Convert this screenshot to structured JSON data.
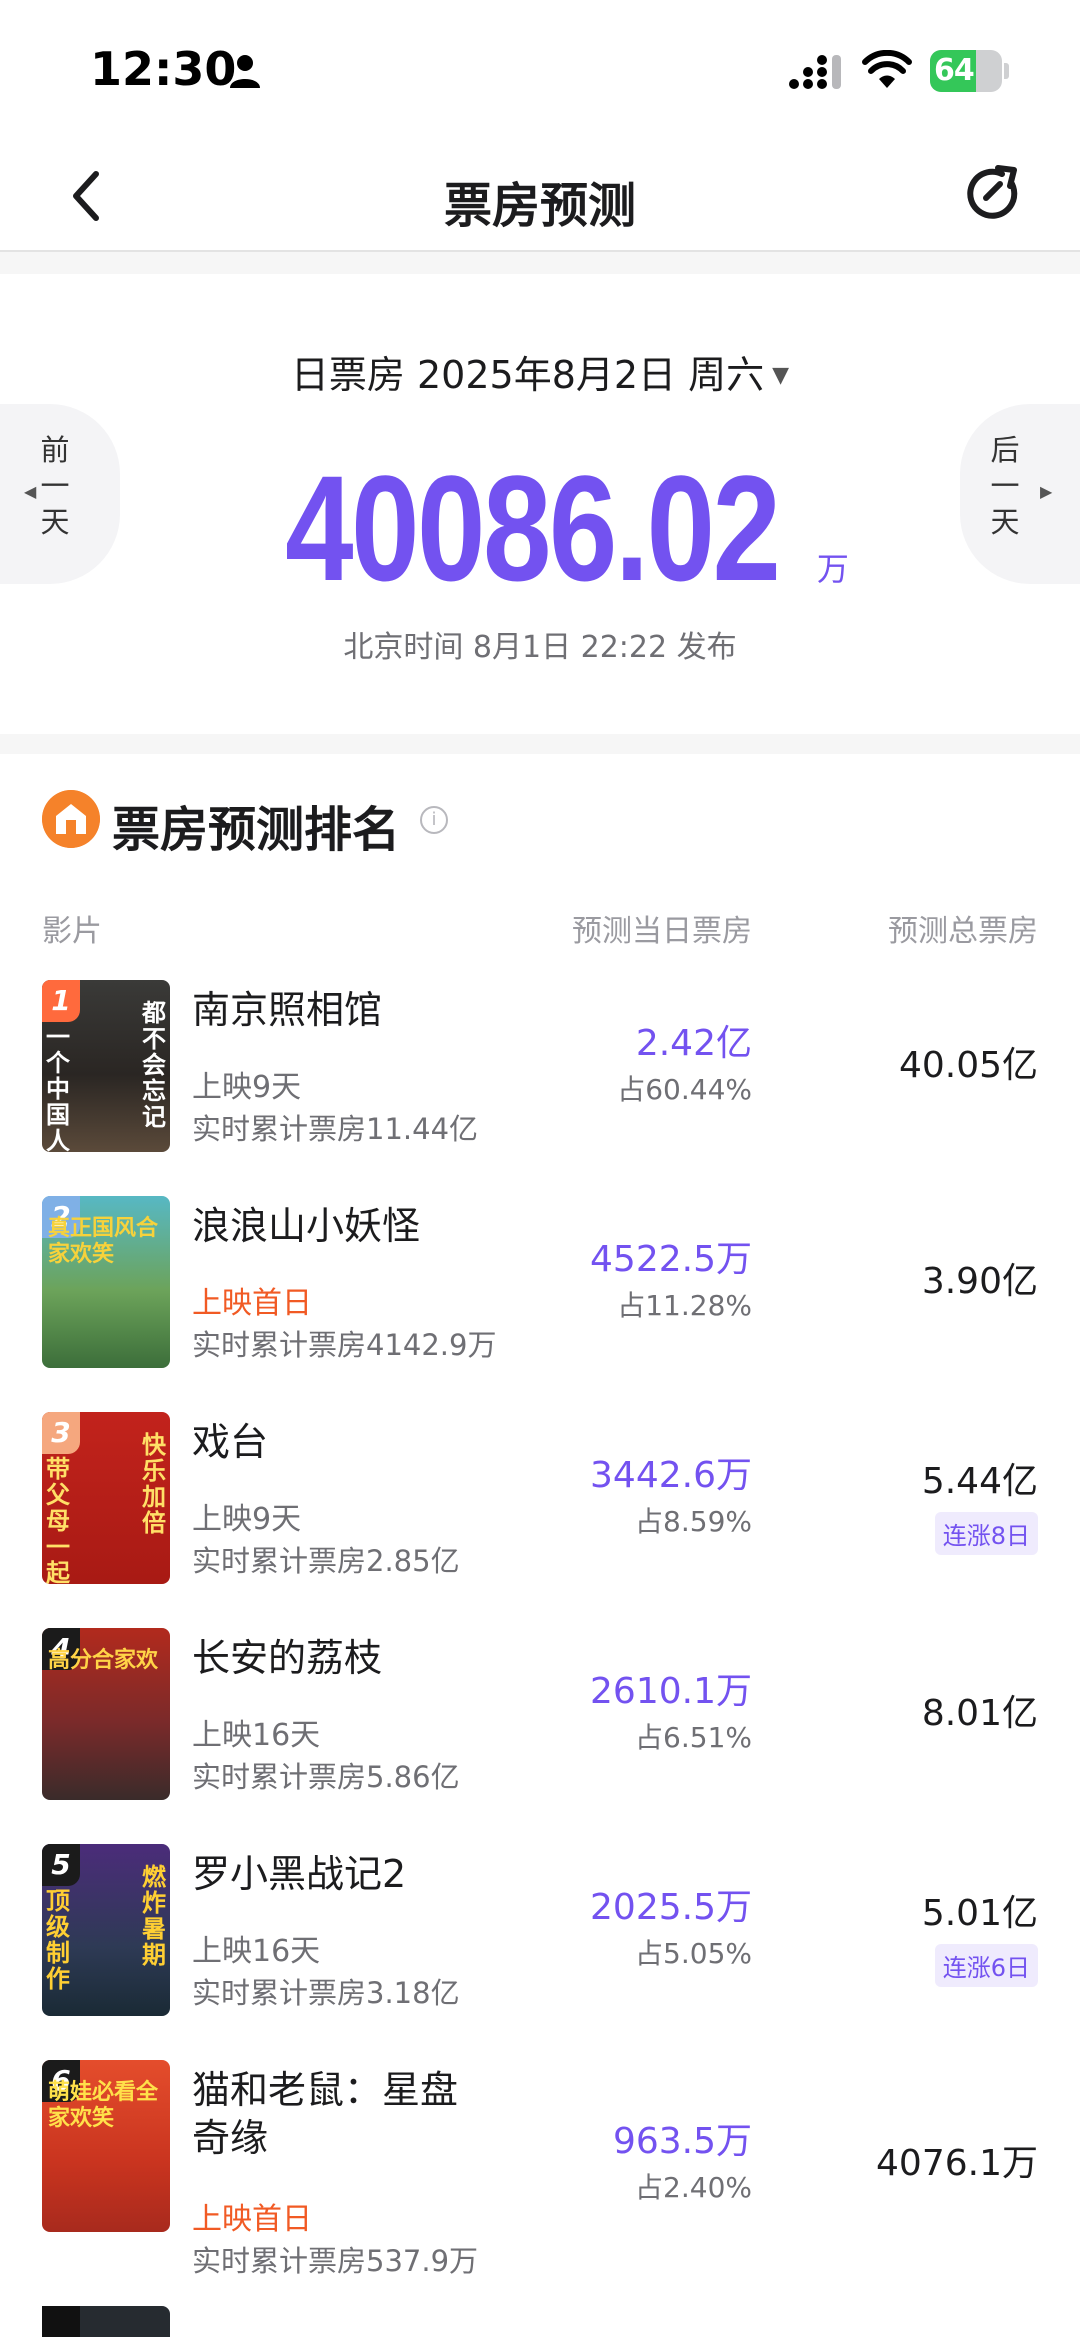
{
  "status_bar": {
    "time": "12:30",
    "battery": "64",
    "battery_level": 0.64,
    "icons": [
      "person-icon",
      "signal-icon",
      "wifi-icon",
      "battery-charging-icon"
    ]
  },
  "nav": {
    "title": "票房预测",
    "icons": [
      "back-chevron-icon",
      "refresh-icon"
    ]
  },
  "summary": {
    "date_label": "日票房 2025年8月2日 周六",
    "prev_day": "前一天",
    "next_day": "后一天",
    "gross_value": "40086.02",
    "gross_unit": "万",
    "publish_time": "北京时间 8月1日 22:22 发布"
  },
  "ranking": {
    "title": "票房预测排名",
    "columns": {
      "film": "影片",
      "day_gross": "预测当日票房",
      "total_gross": "预测总票房"
    },
    "films": [
      {
        "rank": "1",
        "title": "南京照相馆",
        "release": "上映9天",
        "first_day": false,
        "cumulative": "实时累计票房11.44亿",
        "day_gross": "2.42亿",
        "share": "占60.44%",
        "total_gross": "40.05亿",
        "streak": "",
        "badge_color": "#ff6a3d"
      },
      {
        "rank": "2",
        "title": "浪浪山小妖怪",
        "release": "上映首日",
        "first_day": true,
        "cumulative": "实时累计票房4142.9万",
        "day_gross": "4522.5万",
        "share": "占11.28%",
        "total_gross": "3.90亿",
        "streak": "",
        "badge_color": "#7fb0e6"
      },
      {
        "rank": "3",
        "title": "戏台",
        "release": "上映9天",
        "first_day": false,
        "cumulative": "实时累计票房2.85亿",
        "day_gross": "3442.6万",
        "share": "占8.59%",
        "total_gross": "5.44亿",
        "streak": "连涨8日",
        "badge_color": "#f5a77e"
      },
      {
        "rank": "4",
        "title": "长安的荔枝",
        "release": "上映16天",
        "first_day": false,
        "cumulative": "实时累计票房5.86亿",
        "day_gross": "2610.1万",
        "share": "占6.51%",
        "total_gross": "8.01亿",
        "streak": "",
        "badge_color": "#1b1b1b"
      },
      {
        "rank": "5",
        "title": "罗小黑战记2",
        "release": "上映16天",
        "first_day": false,
        "cumulative": "实时累计票房3.18亿",
        "day_gross": "2025.5万",
        "share": "占5.05%",
        "total_gross": "5.01亿",
        "streak": "连涨6日",
        "badge_color": "#1b1b1b"
      },
      {
        "rank": "6",
        "title": "猫和老鼠：星盘奇缘",
        "release": "上映首日",
        "first_day": true,
        "cumulative": "实时累计票房537.9万",
        "day_gross": "963.5万",
        "share": "占2.40%",
        "total_gross": "4076.1万",
        "streak": "",
        "badge_color": "#1b1b1b"
      }
    ],
    "posters": [
      {
        "bg": "linear-gradient(180deg,#3a3a38 0%,#2a2623 55%,#5b4a3a 100%)",
        "text_left": "一个中国人",
        "text_right": "都不会忘记",
        "color": "#ffffff"
      },
      {
        "bg": "linear-gradient(180deg,#57b8c4 0%,#6ca35a 55%,#3c6e3a 100%)",
        "text_left": "",
        "text_right": "",
        "top": "真正国风合家欢笑",
        "color": "#f7d23b"
      },
      {
        "bg": "linear-gradient(180deg,#c2231c 0%,#a81a14 100%)",
        "text_left": "带父母一起看",
        "text_right": "快乐加倍",
        "color": "#ffe067"
      },
      {
        "bg": "linear-gradient(180deg,#b22a1d 0%,#7a2a2a 55%,#3a2b2a 100%)",
        "text_left": "",
        "text_right": "",
        "top": "高分合家欢",
        "color": "#ffd447"
      },
      {
        "bg": "linear-gradient(180deg,#4b2c7a 0%,#2e3a55 60%,#1a2a35 100%)",
        "text_left": "顶级制作",
        "text_right": "燃炸暑期",
        "color": "#ffcf33"
      },
      {
        "bg": "linear-gradient(180deg,#e44d2c 0%,#c9341f 60%,#a82a1d 100%)",
        "text_left": "",
        "text_right": "",
        "top": "萌娃必看全家欢笑",
        "color": "#ffe14a"
      }
    ]
  }
}
